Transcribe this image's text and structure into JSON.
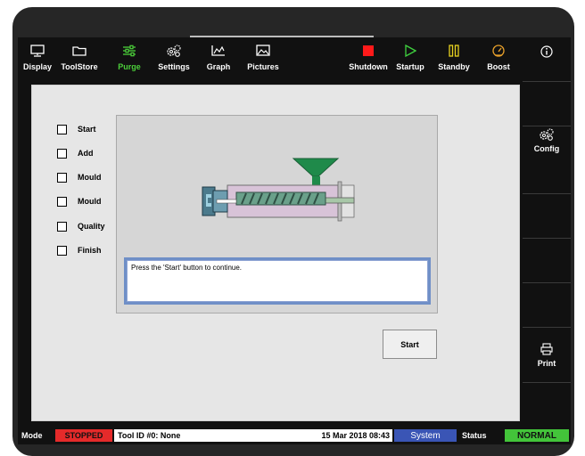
{
  "toolbar": {
    "left": [
      {
        "label": "Display",
        "icon": "monitor-icon"
      },
      {
        "label": "ToolStore",
        "icon": "folder-icon"
      },
      {
        "label": "Purge",
        "icon": "sliders-icon",
        "active": true
      },
      {
        "label": "Settings",
        "icon": "gears-icon"
      },
      {
        "label": "Graph",
        "icon": "graph-icon"
      },
      {
        "label": "Pictures",
        "icon": "picture-icon"
      }
    ],
    "right": [
      {
        "label": "Shutdown",
        "icon": "stop-square-icon",
        "color": "#ff1a1a"
      },
      {
        "label": "Startup",
        "icon": "play-triangle-icon",
        "color": "#3fd13f"
      },
      {
        "label": "Standby",
        "icon": "pause-icon",
        "color": "#e8d21f"
      },
      {
        "label": "Boost",
        "icon": "gauge-icon",
        "color": "#e9a12b"
      }
    ]
  },
  "right_panel": {
    "info_icon": "info-icon",
    "config_label": "Config",
    "print_label": "Print"
  },
  "steps": [
    "Start",
    "Add",
    "Mould",
    "Mould",
    "Quality",
    "Finish"
  ],
  "message": "Press the 'Start' button to continue.",
  "start_button": "Start",
  "status": {
    "mode_label": "Mode",
    "mode_value": "STOPPED",
    "tool_id": "Tool ID #0: None",
    "datetime": "15 Mar 2018 08:43",
    "user": "System",
    "status_label": "Status",
    "status_value": "NORMAL"
  },
  "colors": {
    "active_green": "#4ccf3a",
    "stopped_red": "#e52a2a",
    "system_blue": "#3a55b5",
    "normal_green": "#43c43a",
    "hopper_green": "#1f8a4a"
  }
}
